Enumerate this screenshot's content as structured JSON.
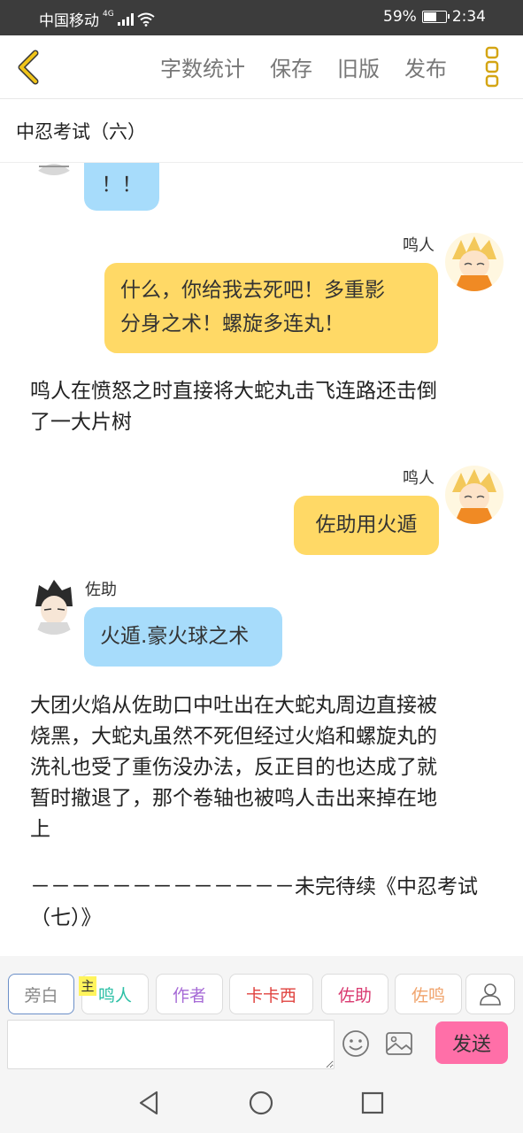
{
  "status_bar": {
    "carrier": "中国移动",
    "network": "4G",
    "battery_percent": "59%",
    "battery_level": 0.59,
    "time": "2:34"
  },
  "toolbar": {
    "word_count": "字数统计",
    "save": "保存",
    "old_version": "旧版",
    "publish": "发布"
  },
  "chapter_title": "中忍考试（六）",
  "messages": {
    "m0": {
      "text": "！！"
    },
    "m1": {
      "name": "鸣人",
      "text_line1": "什么，你给我去死吧！多重影",
      "text_line2": "分身之术！螺旋多连丸！"
    },
    "n1": {
      "line1": "鸣人在愤怒之时直接将大蛇丸击飞连路还击倒",
      "line2": "了一大片树"
    },
    "m2": {
      "name": "鸣人",
      "text": "佐助用火遁"
    },
    "m3": {
      "name": "佐助",
      "text": "火遁.豪火球之术"
    },
    "n2": {
      "line1": "大团火焰从佐助口中吐出在大蛇丸周边直接被",
      "line2": "烧黑，大蛇丸虽然不死但经过火焰和螺旋丸的",
      "line3": "洗礼也受了重伤没办法，反正目的也达成了就",
      "line4": "暂时撤退了，那个卷轴也被鸣人击出来掉在地",
      "line5": "上"
    },
    "n3": {
      "line1": "－－－－－－－－－－－－－未完待续《中忍考试",
      "line2": "（七）》"
    }
  },
  "roles": [
    {
      "label": "旁白",
      "color": "#888888"
    },
    {
      "label": "鸣人",
      "color": "#2bbfa5"
    },
    {
      "label": "作者",
      "color": "#a66ad6"
    },
    {
      "label": "卡卡西",
      "color": "#e0433f"
    },
    {
      "label": "佐助",
      "color": "#d9386f"
    },
    {
      "label": "佐鸣",
      "color": "#f0a36b"
    }
  ],
  "main_role_tag": "主",
  "input": {
    "value": "",
    "placeholder": ""
  },
  "send_label": "发送",
  "colors": {
    "blue_bubble": "#a7dcfb",
    "yellow_bubble": "#ffd966",
    "send": "#ff6fa8",
    "back_arrow": "#f0c419",
    "more_dots": "#d4a514"
  }
}
